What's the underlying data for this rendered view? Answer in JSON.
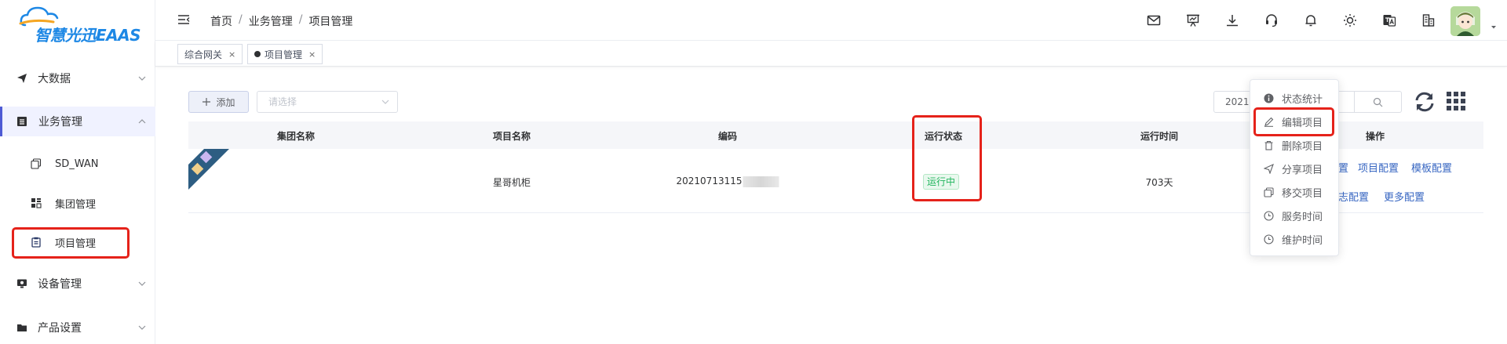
{
  "brand": {
    "logo_text": "智慧光迅EAAS",
    "logo_color": "#1e88e5"
  },
  "sidebar": {
    "items": [
      {
        "label": "大数据",
        "icon": "send-icon"
      },
      {
        "label": "业务管理",
        "icon": "list-icon",
        "expanded": true
      },
      {
        "label": "SD_WAN",
        "icon": "copy-icon"
      },
      {
        "label": "集团管理",
        "icon": "grid-icon"
      },
      {
        "label": "项目管理",
        "icon": "clipboard-icon",
        "selected": true
      },
      {
        "label": "设备管理",
        "icon": "monitor-icon"
      },
      {
        "label": "产品设置",
        "icon": "folder-icon"
      }
    ]
  },
  "header": {
    "breadcrumb": [
      "首页",
      "业务管理",
      "项目管理"
    ],
    "breadcrumb_sep": "/",
    "icons": [
      "mail-icon",
      "presentation-icon",
      "download-icon",
      "headset-icon",
      "bell-icon",
      "sun-icon",
      "translate-icon",
      "building-icon"
    ]
  },
  "tabs": [
    {
      "label": "综合网关",
      "close": "×"
    },
    {
      "label": "项目管理",
      "close": "×",
      "active": true
    }
  ],
  "toolbar": {
    "add_label": "添加",
    "add_icon": "plus-icon",
    "select_placeholder": "请选择",
    "search_value": "2021("
  },
  "table": {
    "columns": [
      "集团名称",
      "项目名称",
      "编码",
      "运行状态",
      "运行时间",
      "操作"
    ],
    "rows": [
      {
        "group": "",
        "project": "星哥机柜",
        "code": "20210713115",
        "status": "运行中",
        "runtime": "703天",
        "ops_row1": [
          "置",
          "项目配置",
          "模板配置"
        ],
        "ops_row2": [
          "志配置",
          "更多配置"
        ]
      }
    ]
  },
  "dropdown": {
    "items": [
      {
        "label": "状态统计",
        "icon": "info-icon"
      },
      {
        "label": "编辑项目",
        "icon": "edit-icon",
        "highlighted": true
      },
      {
        "label": "删除项目",
        "icon": "trash-icon"
      },
      {
        "label": "分享项目",
        "icon": "send-icon"
      },
      {
        "label": "移交项目",
        "icon": "copy-icon"
      },
      {
        "label": "服务时间",
        "icon": "clock-icon"
      },
      {
        "label": "维护时间",
        "icon": "clock-icon"
      }
    ]
  },
  "colors": {
    "accent": "#4e5bd4",
    "link": "#3766c2",
    "status_green": "#22b55e",
    "highlight_red": "#e5221a"
  }
}
